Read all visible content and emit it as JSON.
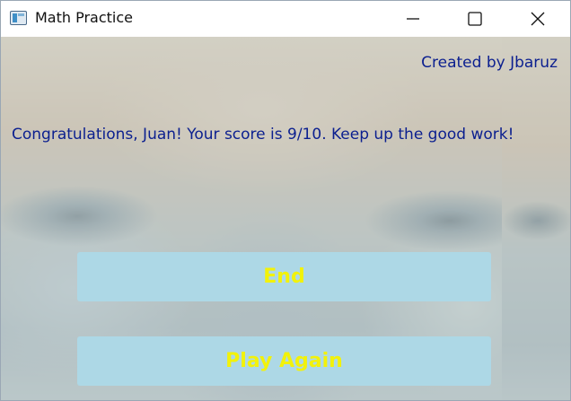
{
  "window": {
    "title": "Math Practice",
    "controls": [
      "minimize-icon",
      "maximize-icon",
      "close-icon"
    ]
  },
  "header": {
    "credit": "Created by Jbaruz"
  },
  "main": {
    "message": "Congratulations, Juan! Your score is 9/10. Keep up the good work!"
  },
  "buttons": {
    "end_label": "End",
    "play_again_label": "Play Again"
  },
  "colors": {
    "text_blue": "#0b1f8f",
    "button_bg": "#add8e6",
    "button_text": "#f2f20a"
  }
}
